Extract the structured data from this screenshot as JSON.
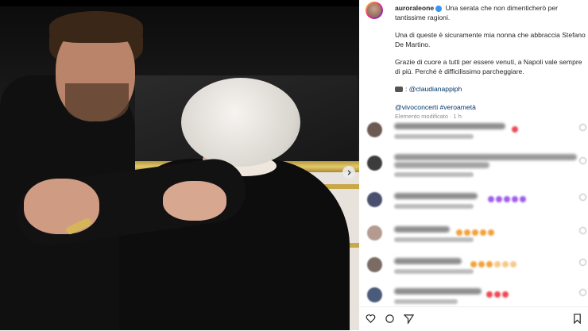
{
  "post": {
    "username": "auroraleone",
    "caption_line1": "Una serata che non dimenticherò per tantissime ragioni.",
    "caption_line2": "Una di queste è sicuramente mia nonna che abbraccia Stefano De Martino.",
    "caption_line3": "Grazie di cuore a tutti per essere venuti, a Napoli vale sempre di più. Perché è difficilissimo parcheggiare.",
    "photo_credit": "@claudianappiph",
    "tags": "@vivoconcerti #veroametà",
    "edited_meta": "Elemento modificato · 1 h"
  },
  "icons": {
    "verified": "verified-badge-icon",
    "camera": "camera-emoji-icon",
    "next": "chevron-right-icon"
  },
  "colors": {
    "link": "#00376b",
    "verified": "#3897f0",
    "heart": "#ed4956",
    "purple_heart": "#a05cf0",
    "orange_heart": "#f2a23a"
  }
}
